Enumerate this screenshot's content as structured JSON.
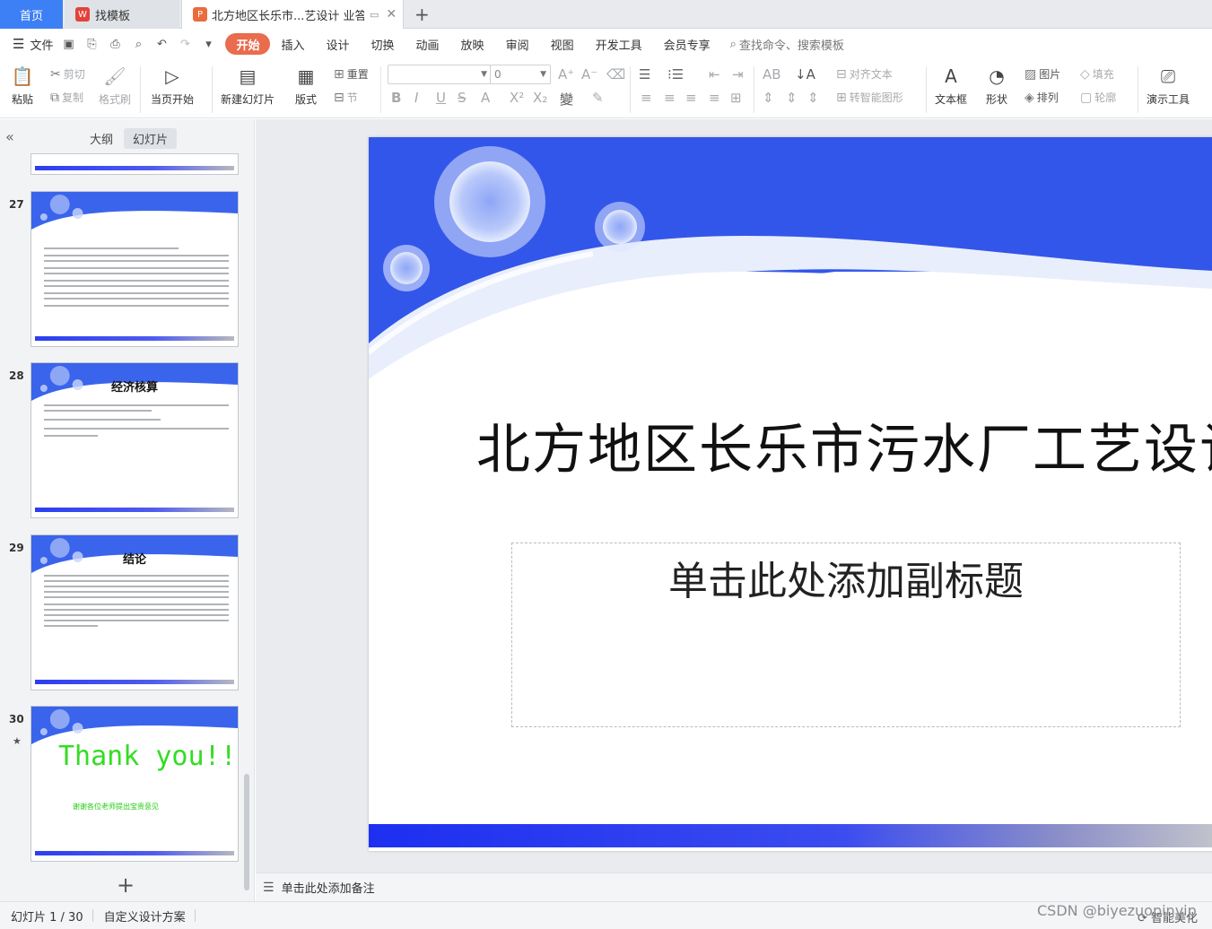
{
  "tabs": {
    "home": "首页",
    "template": "找模板",
    "document": "北方地区长乐市...艺设计 业答辩"
  },
  "menu": {
    "file": "文件",
    "items": [
      "开始",
      "插入",
      "设计",
      "切换",
      "动画",
      "放映",
      "审阅",
      "视图",
      "开发工具",
      "会员专享"
    ],
    "active": "开始",
    "search": "查找命令、搜索模板"
  },
  "ribbon": {
    "paste": "粘贴",
    "cut": "剪切",
    "copy": "复制",
    "format_painter": "格式刷",
    "from_current": "当页开始",
    "new_slide": "新建幻灯片",
    "layout": "版式",
    "reset": "重置",
    "section": "节",
    "font_size_value": "0",
    "align_text": "对齐文本",
    "smart_art": "转智能图形",
    "text_box": "文本框",
    "shape": "形状",
    "picture": "图片",
    "fill": "填充",
    "arrange": "排列",
    "outline": "轮廓",
    "presenter_tools": "演示工具"
  },
  "panel": {
    "tab_outline": "大纲",
    "tab_slides": "幻灯片",
    "active_tab": "幻灯片",
    "slides": [
      {
        "number": "27",
        "title": ""
      },
      {
        "number": "28",
        "title": "经济核算"
      },
      {
        "number": "29",
        "title": "结论"
      },
      {
        "number": "30",
        "title": "Thank you!!",
        "subtitle": "谢谢各位老师提出宝贵意见"
      }
    ]
  },
  "slide": {
    "title": "北方地区长乐市污水厂工艺设计",
    "subtitle_placeholder": "单击此处添加副标题"
  },
  "notes": {
    "placeholder": "单击此处添加备注"
  },
  "status": {
    "slide_counter": "幻灯片 1 / 30",
    "theme": "自定义设计方案",
    "smart_beautify": "智能美化"
  },
  "watermark": "CSDN @biyezuopinvip",
  "colors": {
    "accent_blue": "#3d7ff5",
    "active_menu": "#e86c4d",
    "slide_blue": "#1d2ff0",
    "thank_green": "#33dd22"
  }
}
